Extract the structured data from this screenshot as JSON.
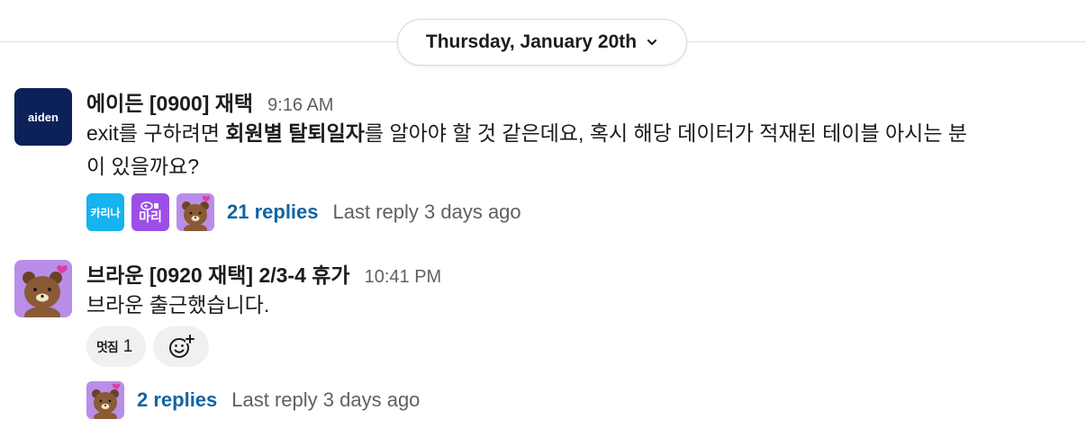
{
  "divider": {
    "date_label": "Thursday, January 20th"
  },
  "messages": [
    {
      "avatar_text": "aiden",
      "sender": "에이든 [0900] 재택",
      "time": "9:16 AM",
      "text_line1_pre": "exit를 구하려면 ",
      "text_line1_bold": "회원별 탈퇴일자",
      "text_line1_post": "를 알아야 할 것 같은데요, 혹시 해당 데이터가 적재된 테이블 아시는 분",
      "text_line2": "이 있을까요?",
      "thread": {
        "avatars": [
          "카리나",
          "마리",
          "brown"
        ],
        "replies": "21 replies",
        "last_reply": "Last reply 3 days ago"
      }
    },
    {
      "sender": "브라운 [0920 재택] 2/3-4 휴가",
      "time": "10:41 PM",
      "text": "브라운 출근했습니다.",
      "reactions": [
        {
          "emoji": "멋짐",
          "count": "1"
        }
      ],
      "thread": {
        "avatars": [
          "brown"
        ],
        "replies": "2 replies",
        "last_reply": "Last reply 3 days ago"
      }
    }
  ],
  "colors": {
    "link": "#1264a3",
    "muted": "#616061",
    "aiden_bg": "#0b2157",
    "karina_bg": "#16b3ef",
    "mari_bg": "#9c4fe6",
    "brown_bg": "#b98ee8"
  }
}
